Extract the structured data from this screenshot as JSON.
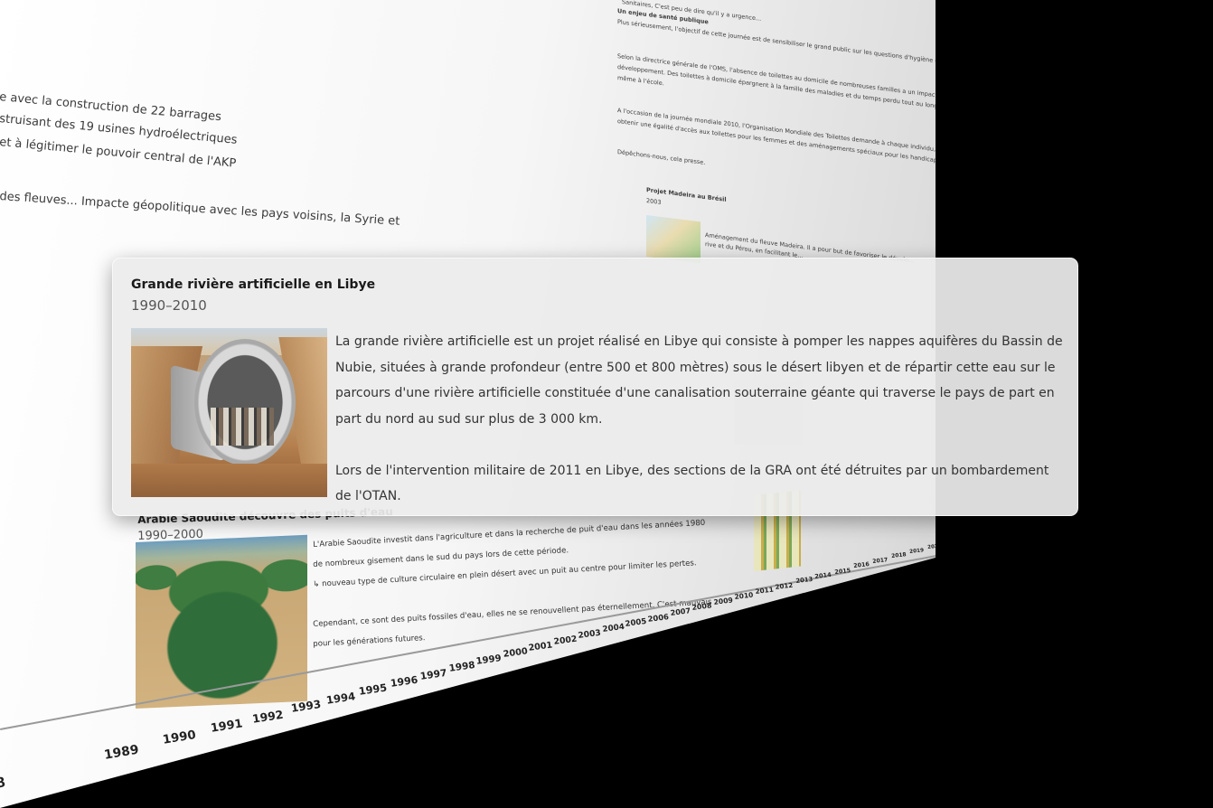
{
  "left_column": {
    "lines": [
      "e avec la construction de 22 barrages",
      "struisant des 19 usines hydroélectriques",
      "et à légitimer le pouvoir central de l'AKP",
      "des fleuves... Impacte géopolitique avec les pays voisins, la Syrie et"
    ]
  },
  "right_column": {
    "lines_top": [
      "Sanitaires, C'est peu de dire qu'il y a urgence...",
      "Un enjeu de santé publique",
      "Plus sérieusement, l'objectif de cette journée est de sensibiliser le grand public sur les questions d'hygiène et l'actuelle situation."
    ],
    "lines_mid": [
      "Selon la directrice générale de l'OMS, l'absence de toilettes au domicile de nombreuses familles a un impact important sur la santé et sur le",
      "développement. Des toilettes à domicile épargnent à la famille des maladies et du temps perdu tout au long de la journée de travail ou",
      "même à l'école."
    ],
    "lines_bottom": [
      "A l'occasion de la journée mondiale 2010, l'Organisation Mondiale des Toilettes demande à chaque individu, dans son pays, de militer pour",
      "obtenir une égalité d'accès aux toilettes pour les femmes et des aménagements spéciaux pour les handicapés.",
      "Dépêchons-nous, cela presse."
    ],
    "madeira_title": "Projet Madeira au Brésil",
    "madeira_year": "2003",
    "madeira_line_1": "Aménagement du fleuve Madeira. Il a pour but de favoriser le dévelo...",
    "madeira_line_2": "rive et du Pérou, en facilitant le..."
  },
  "popup": {
    "title": "Grande rivière artificielle en Libye",
    "date": "1990–2010",
    "image_alt": "pipeline-photo",
    "paragraph_1": "La grande rivière artificielle est un projet réalisé en Libye qui consiste à pomper les nappes aquifères du Bassin de Nubie, situées à grande profondeur (entre 500 et 800 mètres) sous le désert libyen et de répartir cette eau sur le parcours d'une rivière artificielle constituée d'une canalisation souterraine géante qui traverse le pays de part en part du nord au sud sur plus de 3 000 km.",
    "paragraph_2": "Lors de l'intervention militaire de 2011 en Libye, des sections de la GRA ont été détruites par un bombardement de l'OTAN."
  },
  "arabia": {
    "title": "Arabie Saoudite découvre des puits d'eau",
    "date": "1990–2000",
    "lines": [
      "L'Arabie Saoudite investit dans l'agriculture et dans la recherche de puit d'eau dans les années 1980",
      "de nombreux gisement dans le sud du pays lors de cette période.",
      "↳ nouveau type de culture circulaire en plein désert avec un puit au centre pour limiter les pertes.",
      "",
      "Cependant, ce sont des puits fossiles d'eau, elles ne se renouvellent pas éternellement. C'est mauvais",
      "pour les générations futures."
    ]
  },
  "timeline": {
    "years": [
      "8",
      "1989",
      "1990",
      "1991",
      "1992",
      "1993",
      "1994",
      "1995",
      "1996",
      "1997",
      "1998",
      "1999",
      "2000",
      "2001",
      "2002",
      "2003",
      "2004",
      "2005",
      "2006",
      "2007",
      "2008",
      "2009",
      "2010",
      "2011",
      "2012",
      "2013",
      "2014",
      "2015",
      "2016",
      "2017",
      "2018",
      "2019",
      "2020"
    ]
  }
}
